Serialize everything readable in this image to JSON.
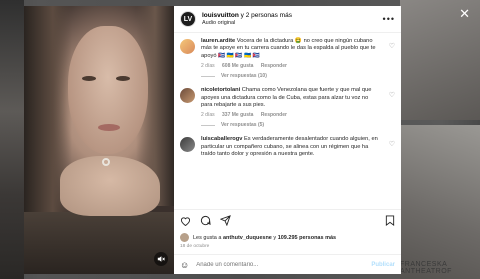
{
  "post": {
    "author": "louisvuitton",
    "coauthors": "y 2 personas más",
    "audio": "Audio original",
    "more_label": "•••"
  },
  "comments": [
    {
      "user": "lauren.ardite",
      "text": "Vocera de la dictadura 🤮 no creo que ningún cubano más te apoye en tu carrera cuando le das la espalda al pueblo que te apoyó 🇨🇺 🇺🇦 🇨🇺 🇺🇦 🇨🇺",
      "age": "2 días",
      "likes": "608 Me gusta",
      "reply": "Responder",
      "replies": "Ver respuestas (10)"
    },
    {
      "user": "nicoletortolani",
      "text": "Chama como Venezolana que fuerte y que mal que apoyes una dictadura como la de Cuba, estas para alzar tu voz no para rebajarte a sus pies.",
      "age": "2 días",
      "likes": "337 Me gusta",
      "reply": "Responder",
      "replies": "Ver respuestas (5)"
    },
    {
      "user": "luiscaballerogv",
      "text": "Es verdaderamente desalentador cuando alguien, en particular un compañero cubano, se alinea con un régimen que ha traído tanto dolor y opresión a nuestra gente."
    }
  ],
  "likes": {
    "prefix": "Les gusta a ",
    "user": "anthutv_duquesne",
    "middle": " y ",
    "count": "109.295 personas más"
  },
  "date": "18 de octubre",
  "add_comment": {
    "placeholder": "Añade un comentario...",
    "publish": "Publicar"
  },
  "background": {
    "watermark": "FRANCESKA ANTHEATROF"
  },
  "colors": {
    "link_blue": "#b2dffc",
    "muted": "#8e8e8e",
    "text": "#262626"
  }
}
